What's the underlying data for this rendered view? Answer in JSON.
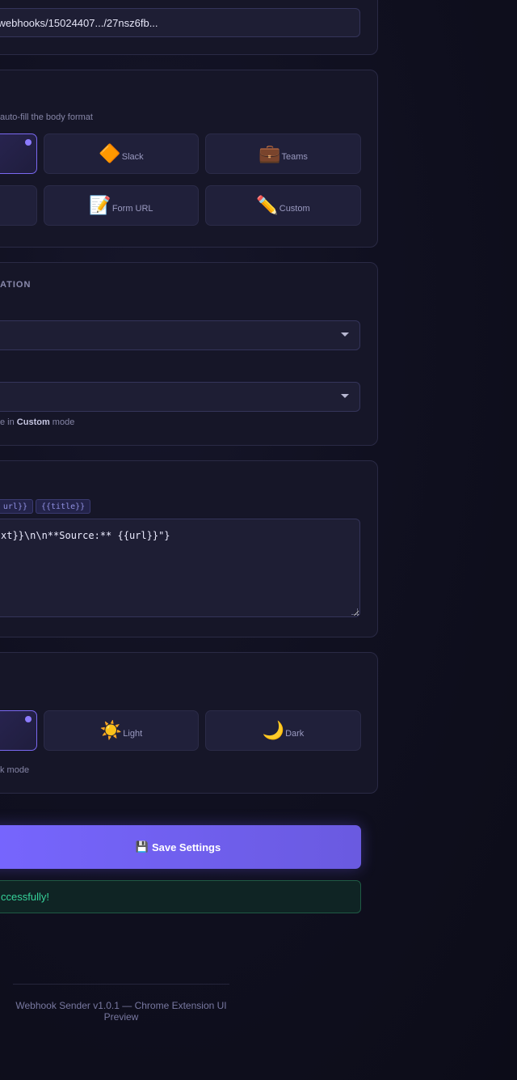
{
  "webhook": {
    "url_value": "i/webhooks/15024407.../27nsz6fb..."
  },
  "format": {
    "hint": "auto-fill the body format",
    "tiles": [
      {
        "label": "",
        "icon": "",
        "active": true
      },
      {
        "label": "Slack",
        "icon": "🔶",
        "active": false
      },
      {
        "label": "Teams",
        "icon": "💼",
        "active": false
      },
      {
        "label": "",
        "icon": "",
        "active": false
      },
      {
        "label": "Form URL",
        "icon": "📝",
        "active": false
      },
      {
        "label": "Custom",
        "icon": "✏️",
        "active": false
      }
    ]
  },
  "configuration": {
    "section_label": "ATION",
    "hint_prefix": "e in ",
    "hint_bold": "Custom",
    "hint_suffix": " mode"
  },
  "template": {
    "chip_url": "url}}",
    "chip_title": "{{title}}",
    "body_value": "xt}}\\n\\n**Source:** {{url}}\"}"
  },
  "theme": {
    "tiles": [
      {
        "label": "",
        "icon": "",
        "active": true
      },
      {
        "label": "Light",
        "icon": "☀️",
        "active": false
      },
      {
        "label": "Dark",
        "icon": "🌙",
        "active": false
      }
    ],
    "hint": "k mode"
  },
  "actions": {
    "save_icon": "💾",
    "save_label": "Save Settings",
    "success_message": "ccessfully!"
  },
  "footer": {
    "text": "Webhook Sender v1.0.1 — Chrome Extension UI Preview"
  },
  "colors": {
    "accent": "#7766ff",
    "success": "#36d39a",
    "panel": "#161628",
    "background": "#0f0f1c"
  }
}
